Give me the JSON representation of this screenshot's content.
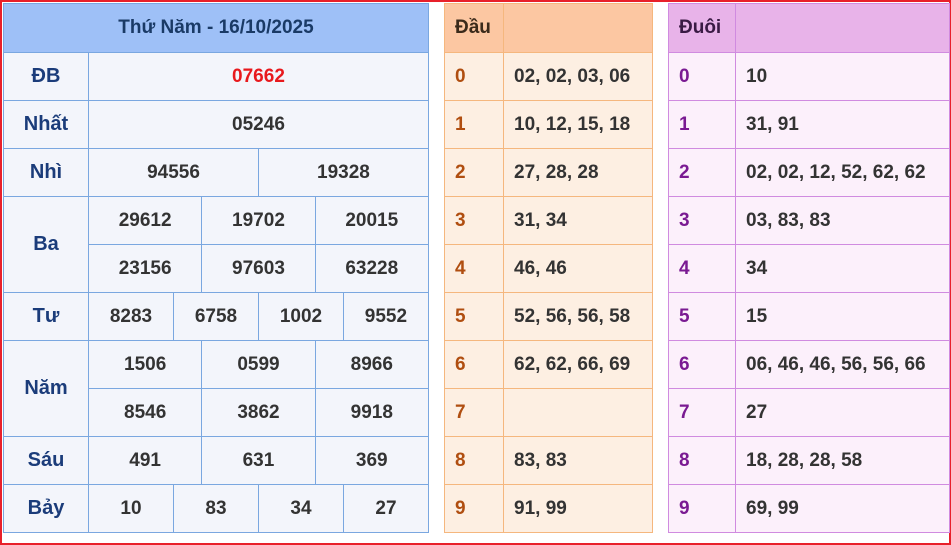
{
  "header": {
    "title": "Thứ Năm - 16/10/2025"
  },
  "prizes": {
    "db": {
      "label": "ĐB",
      "values": [
        "07662"
      ]
    },
    "nhat": {
      "label": "Nhất",
      "values": [
        "05246"
      ]
    },
    "nhi": {
      "label": "Nhì",
      "values": [
        "94556",
        "19328"
      ]
    },
    "ba": {
      "label": "Ba",
      "values": [
        "29612",
        "19702",
        "20015",
        "23156",
        "97603",
        "63228"
      ]
    },
    "tu": {
      "label": "Tư",
      "values": [
        "8283",
        "6758",
        "1002",
        "9552"
      ]
    },
    "nam": {
      "label": "Năm",
      "values": [
        "1506",
        "0599",
        "8966",
        "8546",
        "3862",
        "9918"
      ]
    },
    "sau": {
      "label": "Sáu",
      "values": [
        "491",
        "631",
        "369"
      ]
    },
    "bay": {
      "label": "Bảy",
      "values": [
        "10",
        "83",
        "34",
        "27"
      ]
    }
  },
  "dau": {
    "header": "Đầu",
    "rows": [
      {
        "digit": "0",
        "values": "02, 02, 03, 06"
      },
      {
        "digit": "1",
        "values": "10, 12, 15, 18"
      },
      {
        "digit": "2",
        "values": "27, 28, 28"
      },
      {
        "digit": "3",
        "values": "31, 34"
      },
      {
        "digit": "4",
        "values": "46, 46"
      },
      {
        "digit": "5",
        "values": "52, 56, 56, 58"
      },
      {
        "digit": "6",
        "values": "62, 62, 66, 69"
      },
      {
        "digit": "7",
        "values": ""
      },
      {
        "digit": "8",
        "values": "83, 83"
      },
      {
        "digit": "9",
        "values": "91, 99"
      }
    ]
  },
  "duoi": {
    "header": "Đuôi",
    "rows": [
      {
        "digit": "0",
        "values": "10"
      },
      {
        "digit": "1",
        "values": "31, 91"
      },
      {
        "digit": "2",
        "values": "02, 02, 12, 52, 62, 62"
      },
      {
        "digit": "3",
        "values": "03, 83, 83"
      },
      {
        "digit": "4",
        "values": "34"
      },
      {
        "digit": "5",
        "values": "15"
      },
      {
        "digit": "6",
        "values": "06, 46, 46, 56, 56, 66"
      },
      {
        "digit": "7",
        "values": "27"
      },
      {
        "digit": "8",
        "values": "18, 28, 28, 58"
      },
      {
        "digit": "9",
        "values": "69, 99"
      }
    ]
  },
  "colors": {
    "frame": "#e8202a",
    "special_prize": "#e8191d",
    "main_header": "#9ec0f7",
    "dau_header": "#fcc7a2",
    "duoi_header": "#e8b3e9"
  }
}
